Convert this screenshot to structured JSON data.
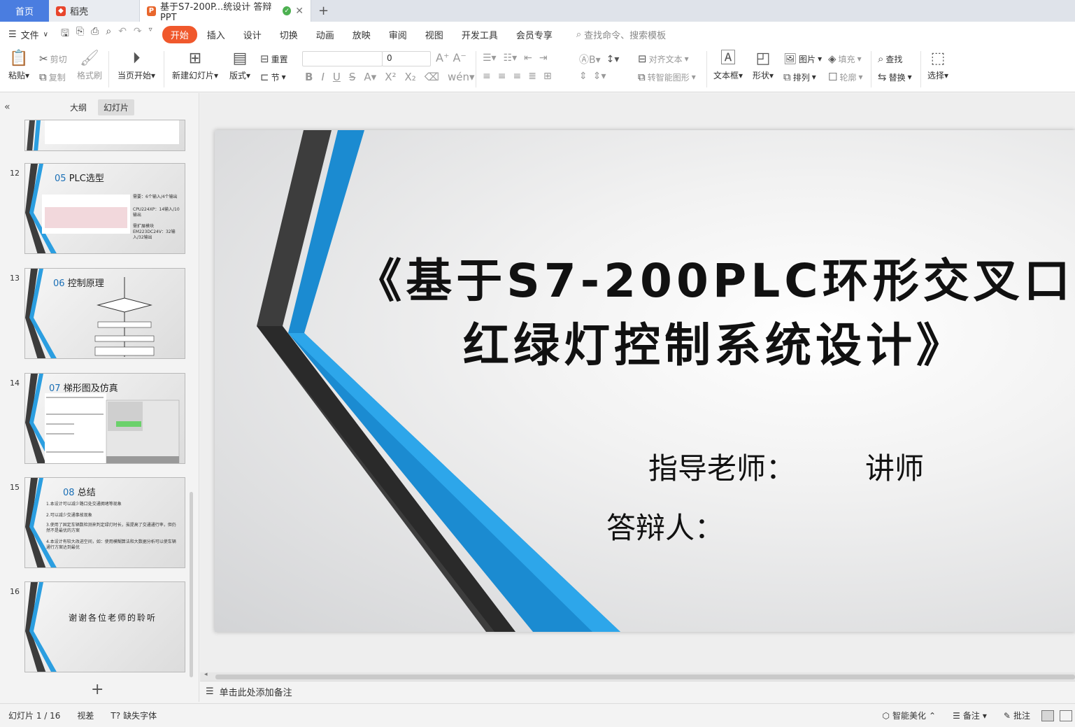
{
  "tabs": {
    "home": "首页",
    "daoke": "稻壳",
    "document": "基于S7-200P...统设计 答辩PPT",
    "new_tab": "+"
  },
  "menu": {
    "file": "文件",
    "items": [
      "开始",
      "插入",
      "设计",
      "切换",
      "动画",
      "放映",
      "审阅",
      "视图",
      "开发工具",
      "会员专享"
    ],
    "active_index": 0,
    "search": "查找命令、搜索模板"
  },
  "ribbon": {
    "paste": "粘贴",
    "cut": "剪切",
    "copy": "复制",
    "format_painter": "格式刷",
    "play_from_current": "当页开始",
    "new_slide": "新建幻灯片",
    "layout": "版式",
    "reset": "重置",
    "section": "节",
    "font_size": "0",
    "align_text": "对齐文本",
    "smart_shape": "转智能图形",
    "text_box": "文本框",
    "shape": "形状",
    "picture": "图片",
    "arrange": "排列",
    "fill": "填充",
    "outline": "轮廓",
    "find": "查找",
    "replace": "替换",
    "select": "选择"
  },
  "left_panel": {
    "tab_outline": "大纲",
    "tab_slides": "幻灯片",
    "thumbnails": [
      {
        "num": "12",
        "index": "05",
        "title": "PLC选型",
        "texts": [
          "需要：6个输入/4个输出",
          "CPU224XP：14输入/10输出",
          "需扩展模块EM223DC24V：32输入/32输出"
        ]
      },
      {
        "num": "13",
        "index": "06",
        "title": "控制原理"
      },
      {
        "num": "14",
        "index": "07",
        "title": "梯形图及仿真"
      },
      {
        "num": "15",
        "index": "08",
        "title": "总结",
        "texts": [
          "1.本设计可以减少路口处交通拥堵等现象",
          "2.可以减少交通事故现象",
          "3.使用了固定车辆数检测来判定绿灯时长，虽提高了交通通行率，但仍然不是最优的方案",
          "4.本设计有较大改进空间，如：使用模糊算法和大数据分析可以使车辆通行方案达到最优"
        ]
      },
      {
        "num": "16",
        "title": "谢谢各位老师的聆听"
      }
    ]
  },
  "slide": {
    "title_line1": "《基于S7-200PLC环形交叉口",
    "title_line2": "红绿灯控制系统设计》",
    "advisor_label": "指导老师：",
    "advisor_name": "讲师",
    "defender_label": "答辩人："
  },
  "notes_placeholder": "单击此处添加备注",
  "status": {
    "slide_counter": "幻灯片 1 / 16",
    "theme": "视差",
    "missing_fonts": "缺失字体",
    "beautify": "智能美化",
    "notes": "备注",
    "comments": "批注"
  },
  "colors": {
    "accent_orange": "#f0582c",
    "home_tab_blue": "#4a7de0",
    "slide_blue": "#1b8bd1",
    "slide_dark": "#3c3c3c"
  }
}
